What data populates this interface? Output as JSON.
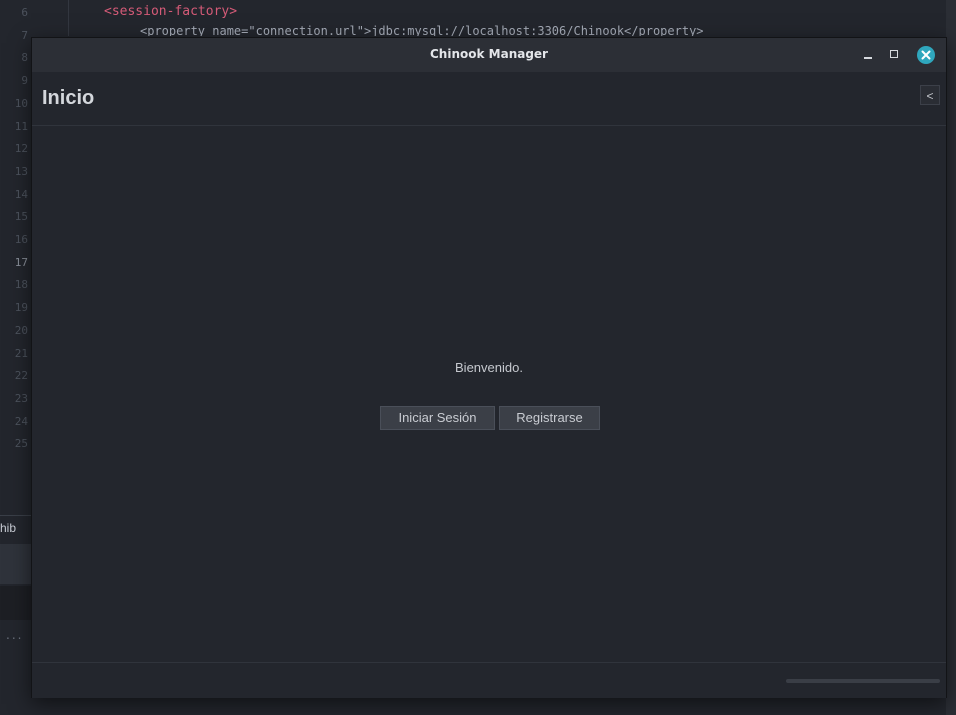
{
  "background_editor": {
    "code_top": "<session-factory>",
    "code_line_2_partial": "<property name=\"connection.url\">jdbc:mysql://localhost:3306/Chinook</property>",
    "line_numbers": [
      "6",
      "7",
      "8",
      "9",
      "10",
      "11",
      "12",
      "13",
      "14",
      "15",
      "16",
      "17",
      "18",
      "19",
      "20",
      "21",
      "22",
      "23",
      "24",
      "25"
    ],
    "active_line": "17",
    "side_label": "hib",
    "dots": "..."
  },
  "window": {
    "title": "Chinook Manager",
    "controls": {
      "minimize_icon": "minimize-icon",
      "maximize_icon": "maximize-icon",
      "close_icon": "close-icon"
    }
  },
  "header": {
    "title": "Inicio",
    "collapse_label": "<"
  },
  "main": {
    "welcome_text": "Bienvenido.",
    "login_button": "Iniciar Sesión",
    "register_button": "Registrarse"
  },
  "colors": {
    "accent_close": "#2fa7bd",
    "background": "#23262d",
    "titlebar": "#2c2f36",
    "button": "#3b3f47"
  }
}
